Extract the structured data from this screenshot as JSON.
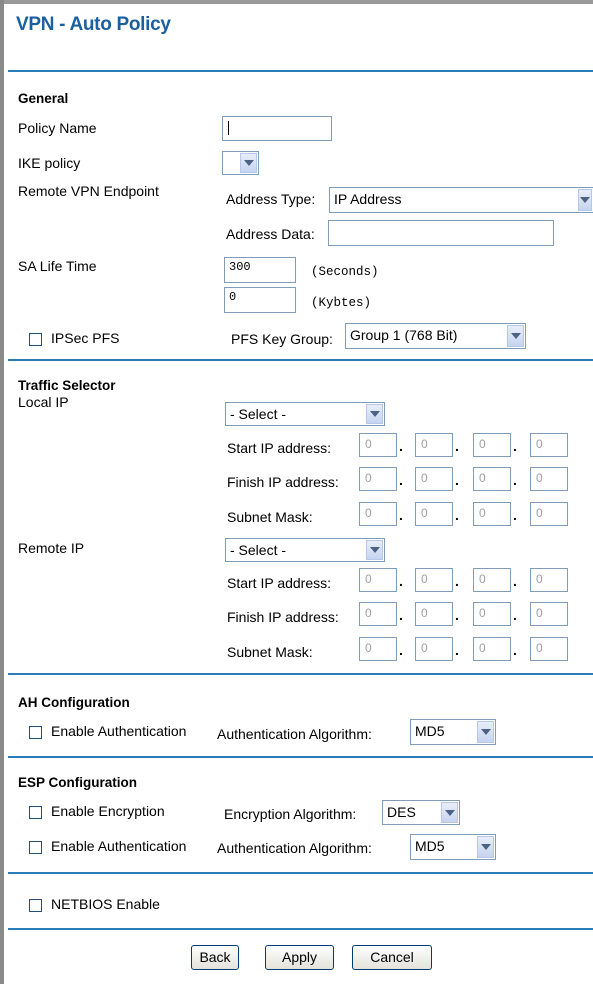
{
  "title": "VPN - Auto Policy",
  "general": {
    "heading": "General",
    "policy_name_label": "Policy Name",
    "policy_name_value": "",
    "ike_policy_label": "IKE policy",
    "ike_policy_value": "",
    "remote_endpoint_label": "Remote VPN Endpoint",
    "address_type_label": "Address Type:",
    "address_type_value": "IP Address",
    "address_data_label": "Address Data:",
    "address_data_value": "",
    "sa_life_label": "SA Life Time",
    "sa_seconds_value": "300",
    "sa_seconds_unit": "(Seconds)",
    "sa_kbytes_value": "0",
    "sa_kbytes_unit": "(Kybtes)",
    "ipsec_pfs_label": "IPSec PFS",
    "pfs_key_group_label": "PFS Key Group:",
    "pfs_key_group_value": "Group 1 (768 Bit)"
  },
  "traffic": {
    "heading": "Traffic Selector",
    "local_ip_label": "Local IP",
    "local_select_value": "- Select -",
    "remote_ip_label": "Remote IP",
    "remote_select_value": "- Select -",
    "start_ip_label": "Start IP address:",
    "finish_ip_label": "Finish IP address:",
    "subnet_mask_label": "Subnet Mask:",
    "octet_value": "0"
  },
  "ah": {
    "heading": "AH Configuration",
    "enable_auth_label": "Enable Authentication",
    "auth_alg_label": "Authentication Algorithm:",
    "auth_alg_value": "MD5"
  },
  "esp": {
    "heading": "ESP Configuration",
    "enable_enc_label": "Enable Encryption",
    "enc_alg_label": "Encryption Algorithm:",
    "enc_alg_value": "DES",
    "enable_auth_label": "Enable Authentication",
    "auth_alg_label": "Authentication Algorithm:",
    "auth_alg_value": "MD5"
  },
  "netbios_label": "NETBIOS Enable",
  "buttons": {
    "back": "Back",
    "apply": "Apply",
    "cancel": "Cancel"
  },
  "colors": {
    "title": "#1a5f9e",
    "rule": "#2a7db8",
    "frame": "#8a8a8a"
  }
}
